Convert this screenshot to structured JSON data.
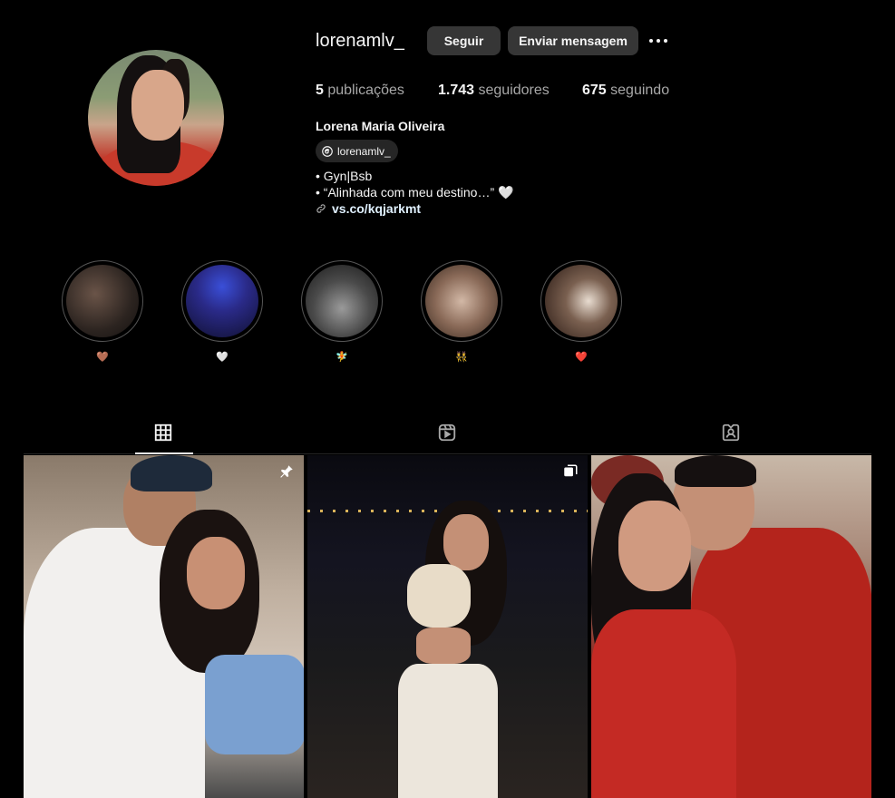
{
  "profile": {
    "username": "lorenamlv_",
    "follow_label": "Seguir",
    "message_label": "Enviar mensagem",
    "posts_count": "5",
    "posts_label": "publicações",
    "followers_count": "1.743",
    "followers_label": "seguidores",
    "following_count": "675",
    "following_label": "seguindo",
    "full_name": "Lorena Maria Oliveira",
    "threads_handle": "lorenamlv_",
    "bio_line1": "• Gyn|Bsb",
    "bio_line2": "• “Alinhada com meu destino…” 🤍",
    "link_text": "vs.co/kqjarkmt"
  },
  "highlights": [
    {
      "caption": "🤎"
    },
    {
      "caption": "🤍"
    },
    {
      "caption": "🧚"
    },
    {
      "caption": "👯"
    },
    {
      "caption": "❤️"
    }
  ],
  "tabs": [
    {
      "icon": "grid-icon",
      "active": true
    },
    {
      "icon": "reels-icon",
      "active": false
    },
    {
      "icon": "tagged-icon",
      "active": false
    }
  ],
  "posts": [
    {
      "badge": "pin-icon"
    },
    {
      "badge": "carousel-icon"
    },
    {
      "badge": ""
    }
  ],
  "colors": {
    "background": "#000000",
    "button_bg": "#363636",
    "secondary_text": "#a8a8a8",
    "link": "#e0f1ff"
  }
}
